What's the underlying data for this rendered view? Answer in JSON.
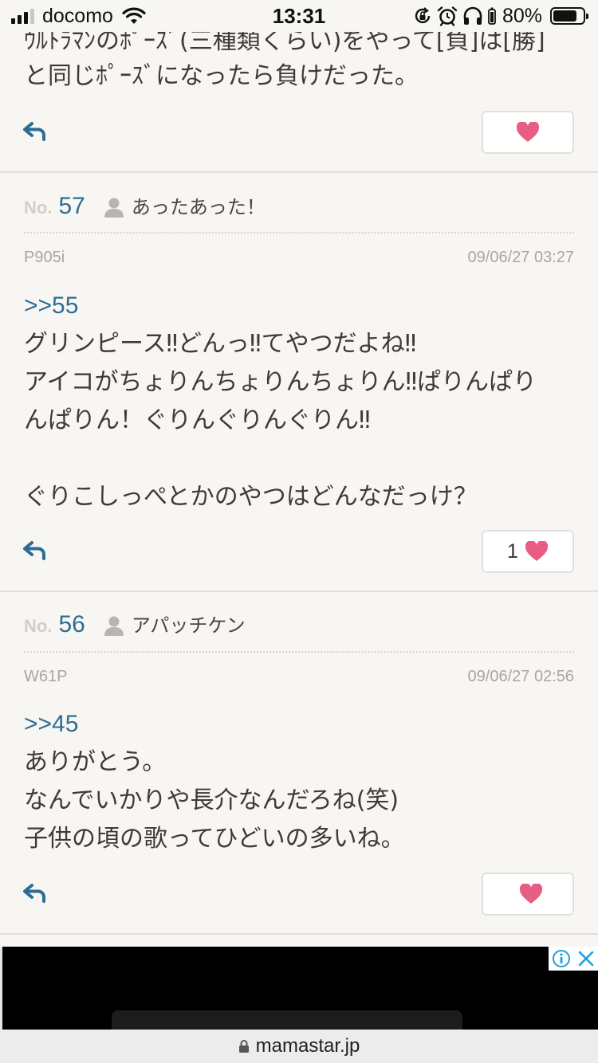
{
  "status_bar": {
    "carrier": "docomo",
    "time": "13:31",
    "battery_percent": "80%",
    "battery_level": 0.8
  },
  "top_post": {
    "text_line1": "ｳﾙﾄﾗﾏﾝのﾎﾟｰｽﾞ(三種類くらい)をやって[負]は[勝]",
    "text_line2": "と同じﾎﾟｰｽﾞになったら負けだった。"
  },
  "posts": [
    {
      "no_label": "No.",
      "number": "57",
      "username": "あったあった！",
      "device": "P905i",
      "date": "09/06/27 03:27",
      "anchor": ">>55",
      "lines": [
        "グリンピース‼どんっ‼てやつだよね‼",
        "アイコがちょりんちょりんちょりん‼ぱりんぱり",
        "んぱりん！ぐりんぐりんぐりん‼",
        "",
        "ぐりこしっぺとかのやつはどんなだっけ？"
      ],
      "likes": "1"
    },
    {
      "no_label": "No.",
      "number": "56",
      "username": "アパッチケン",
      "device": "W61P",
      "date": "09/06/27 02:56",
      "anchor": ">>45",
      "lines": [
        "ありがとう。",
        "なんでいかりや長介なんだろね(笑)",
        "子供の頃の歌ってひどいの多いね。"
      ],
      "likes": ""
    }
  ],
  "colors": {
    "background": "#f8f6f3",
    "link_blue": "#2e6d93",
    "heart_pink": "#e85d84",
    "divider": "#e2e0dc"
  },
  "browser": {
    "url": "mamastar.jp"
  }
}
